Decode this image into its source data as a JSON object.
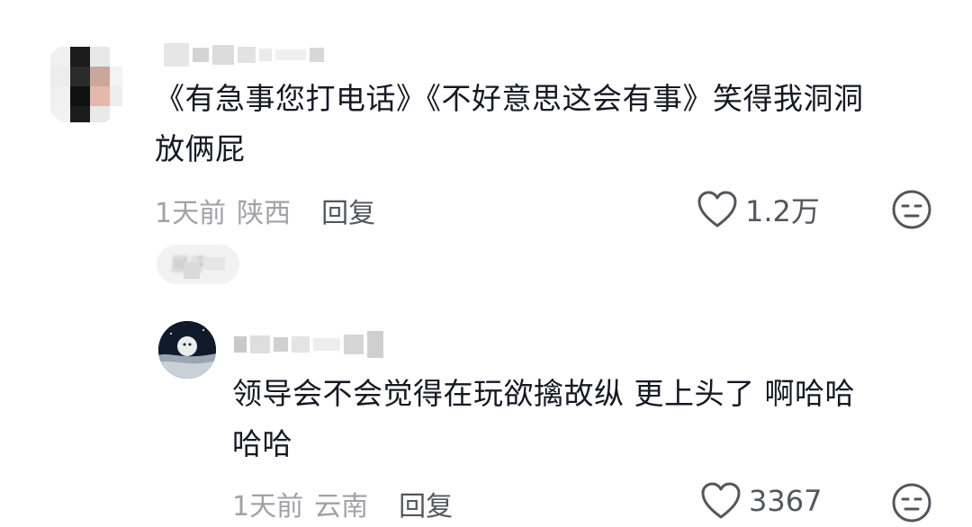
{
  "comments": [
    {
      "text_line1": "《有急事您打电话》《不好意思这会有事》笑得我洞洞",
      "text_line2": "放俩屁",
      "time": "1天前",
      "location": "陕西",
      "reply_label": "回复",
      "likes": "1.2万",
      "like_icon": "heart-outline-icon",
      "dislike_icon": "neutral-face-icon"
    }
  ],
  "expand_replies": {
    "label": "展评"
  },
  "replies": [
    {
      "text_line1": "领导会不会觉得在玩欲擒故纵 更上头了 啊哈哈",
      "text_line2": "哈哈",
      "time": "1天前",
      "location": "云南",
      "reply_label": "回复",
      "likes": "3367",
      "like_icon": "heart-outline-icon",
      "dislike_icon": "neutral-face-icon"
    }
  ],
  "colors": {
    "text_primary": "#161823",
    "text_secondary": "#a1a2a7",
    "icon": "#54565d"
  }
}
